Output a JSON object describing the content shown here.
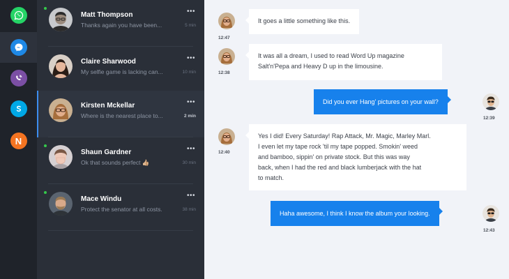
{
  "apps": [
    {
      "name": "whatsapp",
      "icon": "whatsapp-icon",
      "color": "#25d366"
    },
    {
      "name": "messenger",
      "icon": "messenger-icon",
      "color": "#1e88e5",
      "active": true
    },
    {
      "name": "viber",
      "icon": "viber-icon",
      "color": "#7b4fa4"
    },
    {
      "name": "skype",
      "icon": "skype-icon",
      "color": "#00a8e6"
    },
    {
      "name": "n-app",
      "icon": "n-app-icon",
      "color": "#f47421",
      "letter": "N"
    }
  ],
  "conversations": [
    {
      "name": "Matt Thompson",
      "preview": "Thanks again you have been...",
      "time": "5 min",
      "online": true,
      "selected": false,
      "avatar_bg": "#c7c9cc",
      "avatar_skin": "#9a8a7c",
      "avatar_hair": "#2b2b2b"
    },
    {
      "name": "Claire Sharwood",
      "preview": "My selfie game is lacking can...",
      "time": "10 min",
      "online": false,
      "selected": false,
      "avatar_bg": "#d8cfc6",
      "avatar_skin": "#e5b79c",
      "avatar_hair": "#2a1d16"
    },
    {
      "name": "Kirsten Mckellar",
      "preview": "Where is the nearest place to...",
      "time": "2 min",
      "online": false,
      "selected": true,
      "avatar_bg": "#c9b091",
      "avatar_skin": "#e2ae8c",
      "avatar_hair": "#a66e3c"
    },
    {
      "name": "Shaun Gardner",
      "preview": "Ok that sounds perfect 👍🏼",
      "time": "30 min",
      "online": true,
      "selected": false,
      "avatar_bg": "#d6d0d2",
      "avatar_skin": "#efc9b8",
      "avatar_hair": "#7a5845"
    },
    {
      "name": "Mace Windu",
      "preview": "Protect the senator at all costs.",
      "time": "38 min",
      "online": true,
      "selected": false,
      "avatar_bg": "#5a6470",
      "avatar_skin": "#d8a98a",
      "avatar_hair": "#9a7a55"
    }
  ],
  "messages": [
    {
      "direction": "in",
      "time": "12:47",
      "lines": [
        "It goes a little something like this."
      ],
      "avatar_bg": "#c9b091",
      "avatar_skin": "#e2ae8c",
      "avatar_hair": "#a66e3c"
    },
    {
      "direction": "in",
      "time": "12:38",
      "lines": [
        "It was all a dream, I used to read Word Up magazine",
        "Salt'n'Pepa and Heavy D up in the limousine."
      ],
      "avatar_bg": "#c9b091",
      "avatar_skin": "#e2ae8c",
      "avatar_hair": "#a66e3c"
    },
    {
      "direction": "out",
      "time": "12:39",
      "lines": [
        "Did you ever Hang' pictures on your wall?"
      ],
      "avatar_bg": "#e8e4df",
      "avatar_skin": "#e0b48f",
      "avatar_hair": "#3a2a1c"
    },
    {
      "direction": "in",
      "time": "12:40",
      "lines": [
        "Yes I did! Every Saturday! Rap Attack, Mr. Magic, Marley Marl.",
        "I even let my tape rock 'til my tape popped. Smokin' weed",
        "and bamboo, sippin' on private stock.  But this was way",
        "back, when I had the red and black lumberjack with the hat",
        "to match."
      ],
      "avatar_bg": "#c9b091",
      "avatar_skin": "#e2ae8c",
      "avatar_hair": "#a66e3c"
    },
    {
      "direction": "out",
      "time": "12:43",
      "lines": [
        "Haha awesome,  I think I know the album your looking."
      ],
      "avatar_bg": "#e8e4df",
      "avatar_skin": "#e0b48f",
      "avatar_hair": "#3a2a1c"
    }
  ]
}
